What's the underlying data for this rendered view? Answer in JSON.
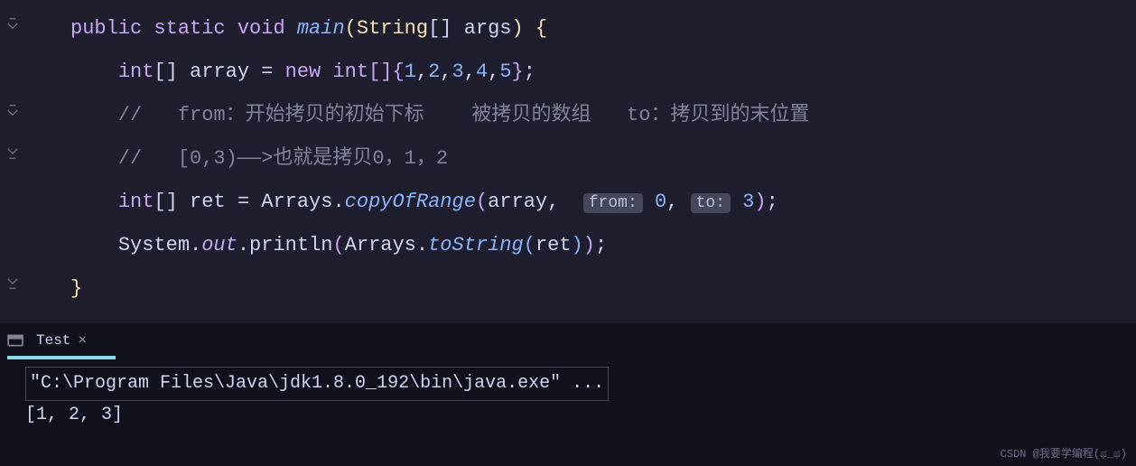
{
  "code": {
    "line1": {
      "public": "public",
      "static": "static",
      "void": "void",
      "main": "main",
      "openParen": "(",
      "type": "String",
      "brackets": "[]",
      "space": " ",
      "args": "args",
      "closeParen": ")",
      "openBrace": " {"
    },
    "line2": {
      "indent": "    ",
      "int": "int",
      "brackets": "[] ",
      "varname": "array = ",
      "new": "new",
      "space": " ",
      "int2": "int",
      "brackets2": "[]",
      "openBrace": "{",
      "n1": "1",
      "c1": ",",
      "n2": "2",
      "c2": ",",
      "n3": "3",
      "c3": ",",
      "n4": "4",
      "c4": ",",
      "n5": "5",
      "closeBrace": "}",
      "semi": ";"
    },
    "line3": {
      "text": "    //   from：开始拷贝的初始下标    被拷贝的数组   to：拷贝到的末位置"
    },
    "line4": {
      "text": "    //   [0,3)——>也就是拷贝0，1，2"
    },
    "line5": {
      "indent": "    ",
      "int": "int",
      "brackets": "[] ",
      "ret": "ret = Arrays.",
      "copyOfRange": "copyOfRange",
      "openParen": "(",
      "array": "array,  ",
      "fromHint": "from:",
      "space1": " ",
      "zero": "0",
      "comma": ", ",
      "toHint": "to:",
      "space2": " ",
      "three": "3",
      "closeParen": ")",
      "semi": ";"
    },
    "line6": {
      "indent": "    ",
      "system": "System.",
      "out": "out",
      "dot": ".",
      "println": "println",
      "openParen": "(",
      "arrays": "Arrays.",
      "toString": "toString",
      "openParen2": "(",
      "ret": "ret",
      "closeParen2": ")",
      "closeParen": ")",
      "semi": ";"
    },
    "line7": {
      "closeBrace": "}"
    }
  },
  "terminal": {
    "tabName": "Test",
    "command": "\"C:\\Program Files\\Java\\jdk1.8.0_192\\bin\\java.exe\" ...",
    "output": "[1, 2, 3]"
  },
  "watermark": "CSDN @我要学编程(ಥ_ಥ)"
}
